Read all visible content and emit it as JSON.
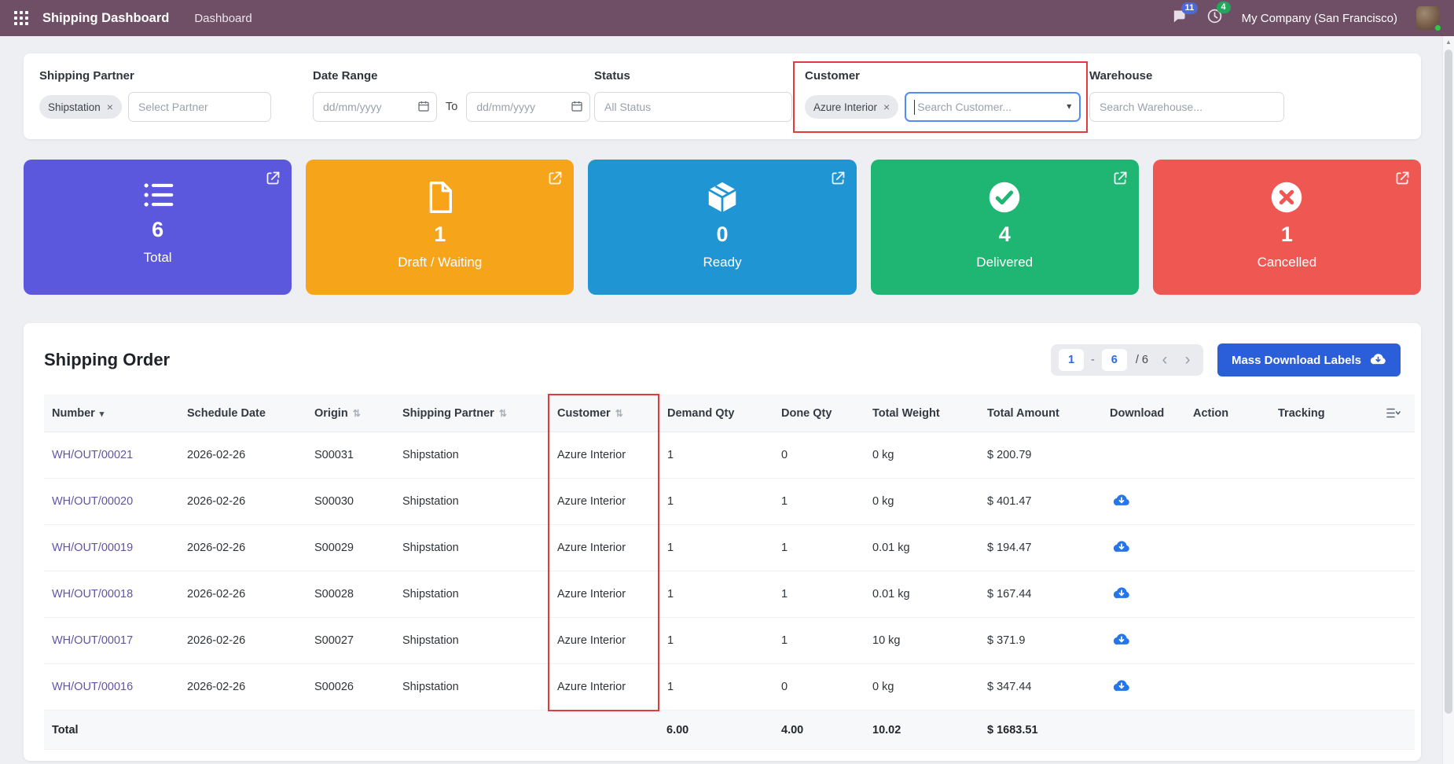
{
  "icons": {
    "close": "×",
    "caret_down": "▾",
    "sort_both": "⇅",
    "sort_desc": "▾",
    "prev": "‹",
    "next": "›",
    "scroll_up": "▲"
  },
  "annotation_color": "#e23b3e",
  "topbar": {
    "app_title": "Shipping Dashboard",
    "menu_dashboard": "Dashboard",
    "messages_badge": "11",
    "activities_badge": "4",
    "company": "My Company (San Francisco)"
  },
  "filters": {
    "shipping_partner": {
      "label": "Shipping Partner",
      "tag": "Shipstation",
      "placeholder": "Select Partner"
    },
    "date_range": {
      "label": "Date Range",
      "from_placeholder": "dd/mm/yyyy",
      "to_label": "To",
      "to_placeholder": "dd/mm/yyyy"
    },
    "status": {
      "label": "Status",
      "placeholder": "All Status"
    },
    "customer": {
      "label": "Customer",
      "tag": "Azure Interior",
      "placeholder": "Search Customer..."
    },
    "warehouse": {
      "label": "Warehouse",
      "placeholder": "Search Warehouse..."
    }
  },
  "stats": [
    {
      "value": "6",
      "label": "Total",
      "color": "#5c58dd",
      "icon": "list-icon"
    },
    {
      "value": "1",
      "label": "Draft / Waiting",
      "color": "#f6a41a",
      "icon": "file-icon"
    },
    {
      "value": "0",
      "label": "Ready",
      "color": "#2095d3",
      "icon": "package-icon"
    },
    {
      "value": "4",
      "label": "Delivered",
      "color": "#1fb573",
      "icon": "check-circle-icon"
    },
    {
      "value": "1",
      "label": "Cancelled",
      "color": "#ef5753",
      "icon": "cancel-circle-icon"
    }
  ],
  "orders": {
    "title": "Shipping Order",
    "pagination": {
      "start": "1",
      "dash": "-",
      "end": "6",
      "total": "/ 6"
    },
    "mass_download_label": "Mass Download Labels",
    "columns": [
      {
        "label": "Number",
        "sort": "desc"
      },
      {
        "label": "Schedule Date",
        "sort": "none"
      },
      {
        "label": "Origin",
        "sort": "both"
      },
      {
        "label": "Shipping Partner",
        "sort": "both"
      },
      {
        "label": "Customer",
        "sort": "both",
        "highlighted": true
      },
      {
        "label": "Demand Qty",
        "sort": "none"
      },
      {
        "label": "Done Qty",
        "sort": "none"
      },
      {
        "label": "Total Weight",
        "sort": "none"
      },
      {
        "label": "Total Amount",
        "sort": "none"
      },
      {
        "label": "Download",
        "sort": "none"
      },
      {
        "label": "Action",
        "sort": "none"
      },
      {
        "label": "Tracking",
        "sort": "none"
      }
    ],
    "rows": [
      {
        "number": "WH/OUT/00021",
        "schedule_date": "2026-02-26",
        "origin": "S00031",
        "shipping_partner": "Shipstation",
        "customer": "Azure Interior",
        "demand_qty": "1",
        "done_qty": "0",
        "total_weight": "0 kg",
        "total_amount": "$ 200.79",
        "has_download": false
      },
      {
        "number": "WH/OUT/00020",
        "schedule_date": "2026-02-26",
        "origin": "S00030",
        "shipping_partner": "Shipstation",
        "customer": "Azure Interior",
        "demand_qty": "1",
        "done_qty": "1",
        "total_weight": "0 kg",
        "total_amount": "$ 401.47",
        "has_download": true
      },
      {
        "number": "WH/OUT/00019",
        "schedule_date": "2026-02-26",
        "origin": "S00029",
        "shipping_partner": "Shipstation",
        "customer": "Azure Interior",
        "demand_qty": "1",
        "done_qty": "1",
        "total_weight": "0.01 kg",
        "total_amount": "$ 194.47",
        "has_download": true
      },
      {
        "number": "WH/OUT/00018",
        "schedule_date": "2026-02-26",
        "origin": "S00028",
        "shipping_partner": "Shipstation",
        "customer": "Azure Interior",
        "demand_qty": "1",
        "done_qty": "1",
        "total_weight": "0.01 kg",
        "total_amount": "$ 167.44",
        "has_download": true
      },
      {
        "number": "WH/OUT/00017",
        "schedule_date": "2026-02-26",
        "origin": "S00027",
        "shipping_partner": "Shipstation",
        "customer": "Azure Interior",
        "demand_qty": "1",
        "done_qty": "1",
        "total_weight": "10 kg",
        "total_amount": "$ 371.9",
        "has_download": true
      },
      {
        "number": "WH/OUT/00016",
        "schedule_date": "2026-02-26",
        "origin": "S00026",
        "shipping_partner": "Shipstation",
        "customer": "Azure Interior",
        "demand_qty": "1",
        "done_qty": "0",
        "total_weight": "0 kg",
        "total_amount": "$ 347.44",
        "has_download": true
      }
    ],
    "totals": {
      "label": "Total",
      "demand_qty": "6.00",
      "done_qty": "4.00",
      "total_weight": "10.02",
      "total_amount": "$ 1683.51"
    }
  }
}
